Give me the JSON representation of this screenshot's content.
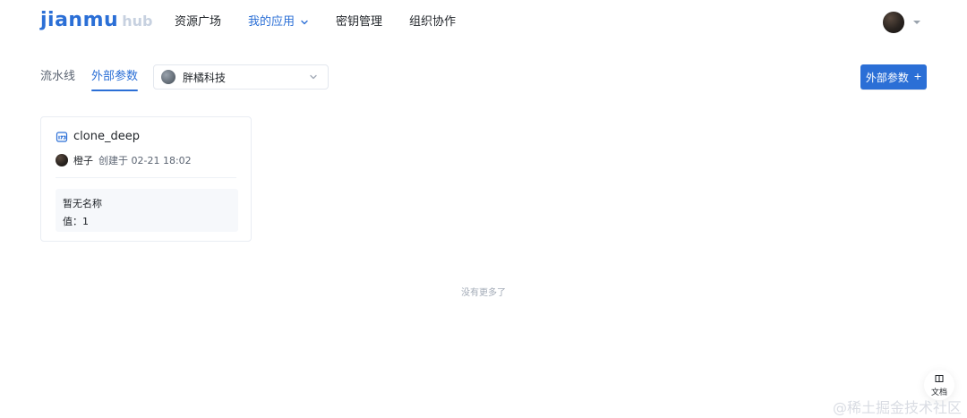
{
  "topbar": {
    "logo": {
      "main": "jianmu",
      "sub": "hub"
    },
    "nav": [
      {
        "label": "资源广场"
      },
      {
        "label": "我的应用",
        "has_dropdown": true,
        "active": true
      },
      {
        "label": "密钥管理"
      },
      {
        "label": "组织协作"
      }
    ]
  },
  "toolbar": {
    "tabs": [
      {
        "label": "流水线",
        "active": false
      },
      {
        "label": "外部参数",
        "active": true
      }
    ],
    "org_select": {
      "selected": "胖橘科技"
    },
    "primary_button_label": "外部参数"
  },
  "cards": [
    {
      "name": "clone_deep",
      "owner": "橙子",
      "created": "创建于 02-21 18:02",
      "detail_title": "暂无名称",
      "detail_value": "值：1"
    }
  ],
  "footer": {
    "no_more": "没有更多了"
  },
  "fab": {
    "label": "文档"
  },
  "watermark": "@稀土掘金技术社区",
  "colors": {
    "accent": "#2b6fd6"
  },
  "icons": {
    "nav_dropdown": "chevron-down-icon",
    "user_menu": "caret-down-icon",
    "org_dropdown": "chevron-down-icon",
    "primary_plus": "plus-icon",
    "param_type": "number-icon",
    "fab": "book-icon"
  }
}
